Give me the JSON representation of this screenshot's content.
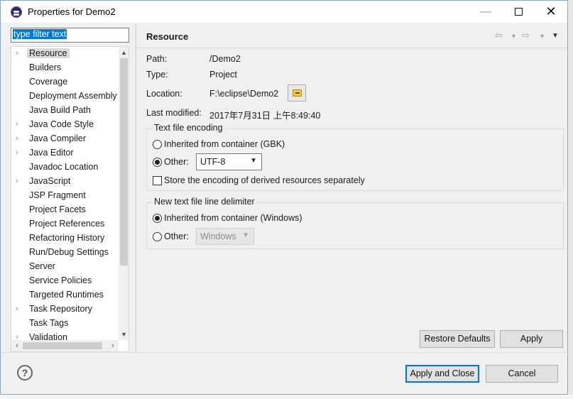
{
  "window": {
    "title": "Properties for Demo2"
  },
  "filter": {
    "placeholder": "type filter text"
  },
  "tree": {
    "items": [
      {
        "label": "Resource",
        "expandable": true,
        "selected": true
      },
      {
        "label": "Builders",
        "expandable": false
      },
      {
        "label": "Coverage",
        "expandable": false
      },
      {
        "label": "Deployment Assembly",
        "expandable": false
      },
      {
        "label": "Java Build Path",
        "expandable": false
      },
      {
        "label": "Java Code Style",
        "expandable": true
      },
      {
        "label": "Java Compiler",
        "expandable": true
      },
      {
        "label": "Java Editor",
        "expandable": true
      },
      {
        "label": "Javadoc Location",
        "expandable": false
      },
      {
        "label": "JavaScript",
        "expandable": true
      },
      {
        "label": "JSP Fragment",
        "expandable": false
      },
      {
        "label": "Project Facets",
        "expandable": false
      },
      {
        "label": "Project References",
        "expandable": false
      },
      {
        "label": "Refactoring History",
        "expandable": false
      },
      {
        "label": "Run/Debug Settings",
        "expandable": false
      },
      {
        "label": "Server",
        "expandable": false
      },
      {
        "label": "Service Policies",
        "expandable": false
      },
      {
        "label": "Targeted Runtimes",
        "expandable": false
      },
      {
        "label": "Task Repository",
        "expandable": true
      },
      {
        "label": "Task Tags",
        "expandable": false
      },
      {
        "label": "Validation",
        "expandable": true
      }
    ]
  },
  "page": {
    "title": "Resource",
    "path_label": "Path:",
    "path_value": "/Demo2",
    "type_label": "Type:",
    "type_value": "Project",
    "location_label": "Location:",
    "location_value": "F:\\eclipse\\Demo2",
    "modified_label": "Last modified:",
    "modified_value": "2017年7月31日 上午8:49:40"
  },
  "encoding": {
    "title": "Text file encoding",
    "inherited_label": "Inherited from container (GBK)",
    "other_label": "Other:",
    "other_value": "UTF-8",
    "store_label": "Store the encoding of derived resources separately"
  },
  "delimiter": {
    "title": "New text file line delimiter",
    "inherited_label": "Inherited from container (Windows)",
    "other_label": "Other:",
    "other_value": "Windows"
  },
  "buttons": {
    "restore_defaults": "Restore Defaults",
    "apply": "Apply",
    "apply_and_close": "Apply and Close",
    "cancel": "Cancel",
    "help": "?"
  },
  "icons": {
    "app": "eclipse-icon",
    "back": "back-arrow-icon",
    "forward": "forward-arrow-icon",
    "menu": "view-menu-icon",
    "folder": "folder-browse-icon",
    "help": "help-icon"
  }
}
